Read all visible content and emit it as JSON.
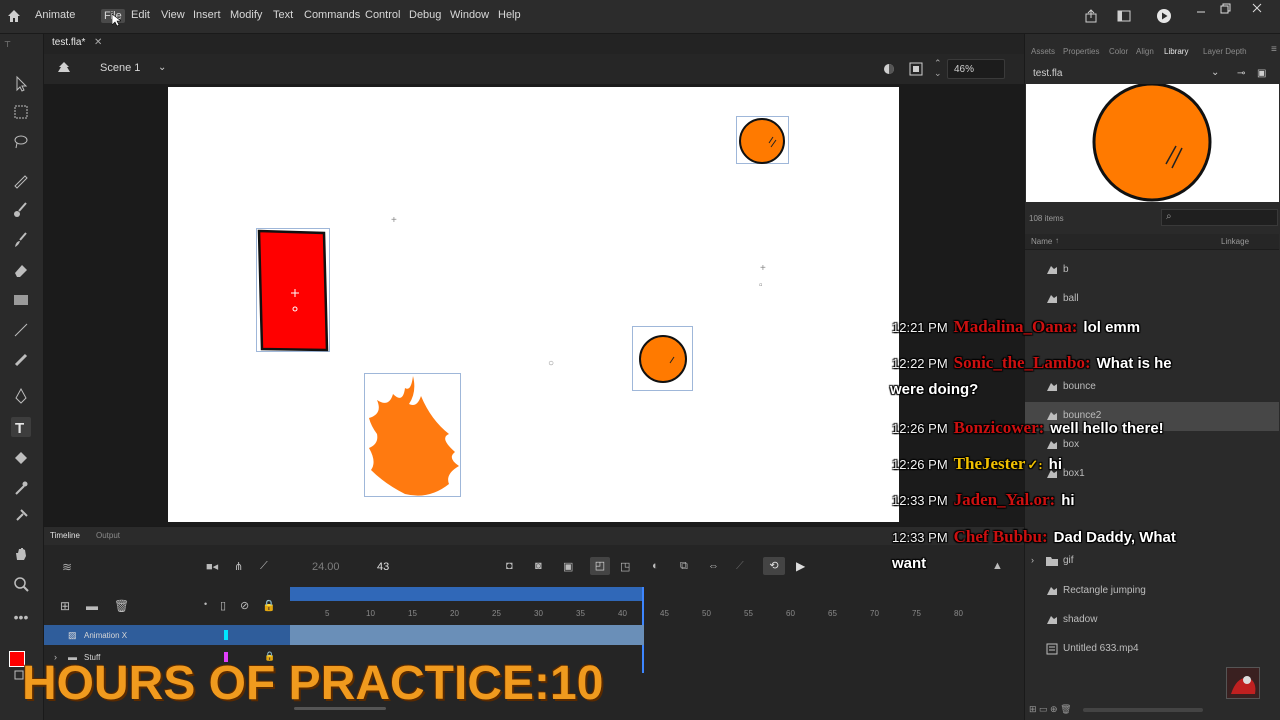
{
  "app": {
    "name": "Animate"
  },
  "menu": [
    "File",
    "Edit",
    "View",
    "Insert",
    "Modify",
    "Text",
    "Commands",
    "Control",
    "Debug",
    "Window",
    "Help"
  ],
  "document": {
    "tab_label": "test.fla*",
    "scene": "Scene 1",
    "zoom": "46%"
  },
  "timeline": {
    "tabs": [
      "Timeline",
      "Output"
    ],
    "fps": "24.00",
    "current_frame": "43",
    "ruler": [
      "5",
      "10",
      "15",
      "20",
      "25",
      "30",
      "35",
      "40",
      "45",
      "50",
      "55",
      "60",
      "65",
      "70",
      "75",
      "80"
    ],
    "layers": [
      {
        "name": "Animation X",
        "color": "#00e5ff"
      },
      {
        "name": "Stuff",
        "color": "#e040fb"
      }
    ]
  },
  "right_panel": {
    "tabs": [
      "Assets",
      "Properties",
      "Color",
      "Align",
      "Library",
      "Layer Depth"
    ],
    "active_tab": "Library",
    "library_doc": "test.fla",
    "item_count": "108 items",
    "column_name": "Name",
    "column_linkage": "Linkage",
    "items": [
      {
        "label": "b",
        "icon": "movieclip-icon"
      },
      {
        "label": "ball",
        "icon": "movieclip-icon"
      },
      {
        "label": "bounce",
        "icon": "movieclip-icon"
      },
      {
        "label": "bounce2",
        "icon": "movieclip-icon",
        "selected": true
      },
      {
        "label": "box",
        "icon": "movieclip-icon"
      },
      {
        "label": "box1",
        "icon": "movieclip-icon"
      },
      {
        "label": "gif",
        "icon": "folder-icon"
      },
      {
        "label": "Rectangle jumping",
        "icon": "movieclip-icon"
      },
      {
        "label": "shadow",
        "icon": "movieclip-icon"
      },
      {
        "label": "Untitled 633.mp4",
        "icon": "video-icon"
      }
    ]
  },
  "overlay": {
    "practice_banner": "HOURS OF PRACTICE:10",
    "chat": [
      {
        "time": "12:21 PM",
        "user": "Madalina_Oana:",
        "message": "lol emm"
      },
      {
        "time": "12:22 PM",
        "user": "Sonic_the_Lambo:",
        "message": "What is he",
        "cont": "were doing?"
      },
      {
        "time": "12:26 PM",
        "user": "Bonzicower:",
        "message": "well hello there!"
      },
      {
        "time": "12:26 PM",
        "user": "TheJester",
        "message": "hi",
        "gold": true
      },
      {
        "time": "12:33 PM",
        "user": "Jaden_Yal.or:",
        "message": "hi"
      },
      {
        "time": "12:33 PM",
        "user": "Chef Bubbu:",
        "message": "Dad Daddy, What",
        "cont": "want"
      }
    ]
  },
  "colors": {
    "stage": "#ffffff",
    "rectangle": "#ff0000",
    "ball": "#ff7a00",
    "flame": "#ff7a10",
    "accent": "#3068b8",
    "banner": "#f09a1e"
  }
}
